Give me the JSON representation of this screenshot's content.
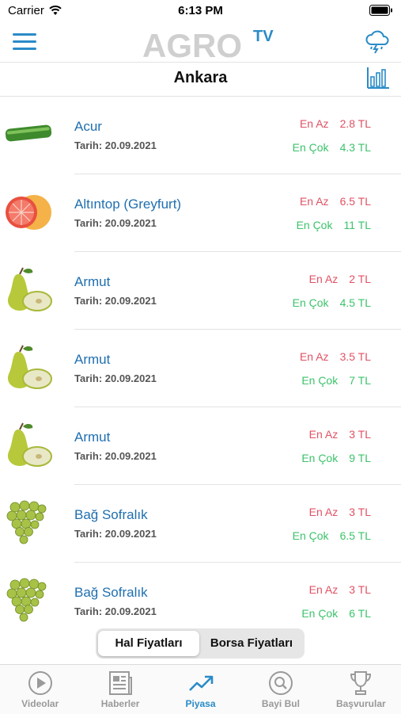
{
  "status_bar": {
    "carrier": "Carrier",
    "time": "6:13 PM"
  },
  "header": {
    "logo_text": "AGRO",
    "logo_superscript": "TV",
    "city": "Ankara"
  },
  "list": {
    "items": [
      {
        "name": "Acur",
        "date": "Tarih: 20.09.2021",
        "min_label": "En Az",
        "min_value": "2.8 TL",
        "max_label": "En Çok",
        "max_value": "4.3 TL",
        "icon": "cucumber"
      },
      {
        "name": "Altıntop (Greyfurt)",
        "date": "Tarih: 20.09.2021",
        "min_label": "En Az",
        "min_value": "6.5 TL",
        "max_label": "En Çok",
        "max_value": "11 TL",
        "icon": "grapefruit"
      },
      {
        "name": "Armut",
        "date": "Tarih: 20.09.2021",
        "min_label": "En Az",
        "min_value": "2 TL",
        "max_label": "En Çok",
        "max_value": "4.5 TL",
        "icon": "pear"
      },
      {
        "name": "Armut",
        "date": "Tarih: 20.09.2021",
        "min_label": "En Az",
        "min_value": "3.5 TL",
        "max_label": "En Çok",
        "max_value": "7 TL",
        "icon": "pear"
      },
      {
        "name": "Armut",
        "date": "Tarih: 20.09.2021",
        "min_label": "En Az",
        "min_value": "3 TL",
        "max_label": "En Çok",
        "max_value": "9 TL",
        "icon": "pear"
      },
      {
        "name": "Bağ Sofralık",
        "date": "Tarih: 20.09.2021",
        "min_label": "En Az",
        "min_value": "3 TL",
        "max_label": "En Çok",
        "max_value": "6.5 TL",
        "icon": "grapes"
      },
      {
        "name": "Bağ Sofralık",
        "date": "Tarih: 20.09.2021",
        "min_label": "En Az",
        "min_value": "3 TL",
        "max_label": "En Çok",
        "max_value": "6 TL",
        "icon": "grapes"
      }
    ]
  },
  "segment": {
    "option1": "Hal Fiyatları",
    "option2": "Borsa Fiyatları",
    "selected": "option1"
  },
  "tabbar": {
    "tabs": [
      {
        "label": "Videolar",
        "icon": "play-icon"
      },
      {
        "label": "Haberler",
        "icon": "newspaper-icon"
      },
      {
        "label": "Piyasa",
        "icon": "trend-up-icon"
      },
      {
        "label": "Bayi Bul",
        "icon": "search-icon"
      },
      {
        "label": "Başvurular",
        "icon": "trophy-icon"
      }
    ],
    "active_index": 2
  },
  "colors": {
    "accent": "#2a8bc7",
    "min_price": "#e05264",
    "max_price": "#3cc36b",
    "product_name": "#1f6fb0"
  }
}
